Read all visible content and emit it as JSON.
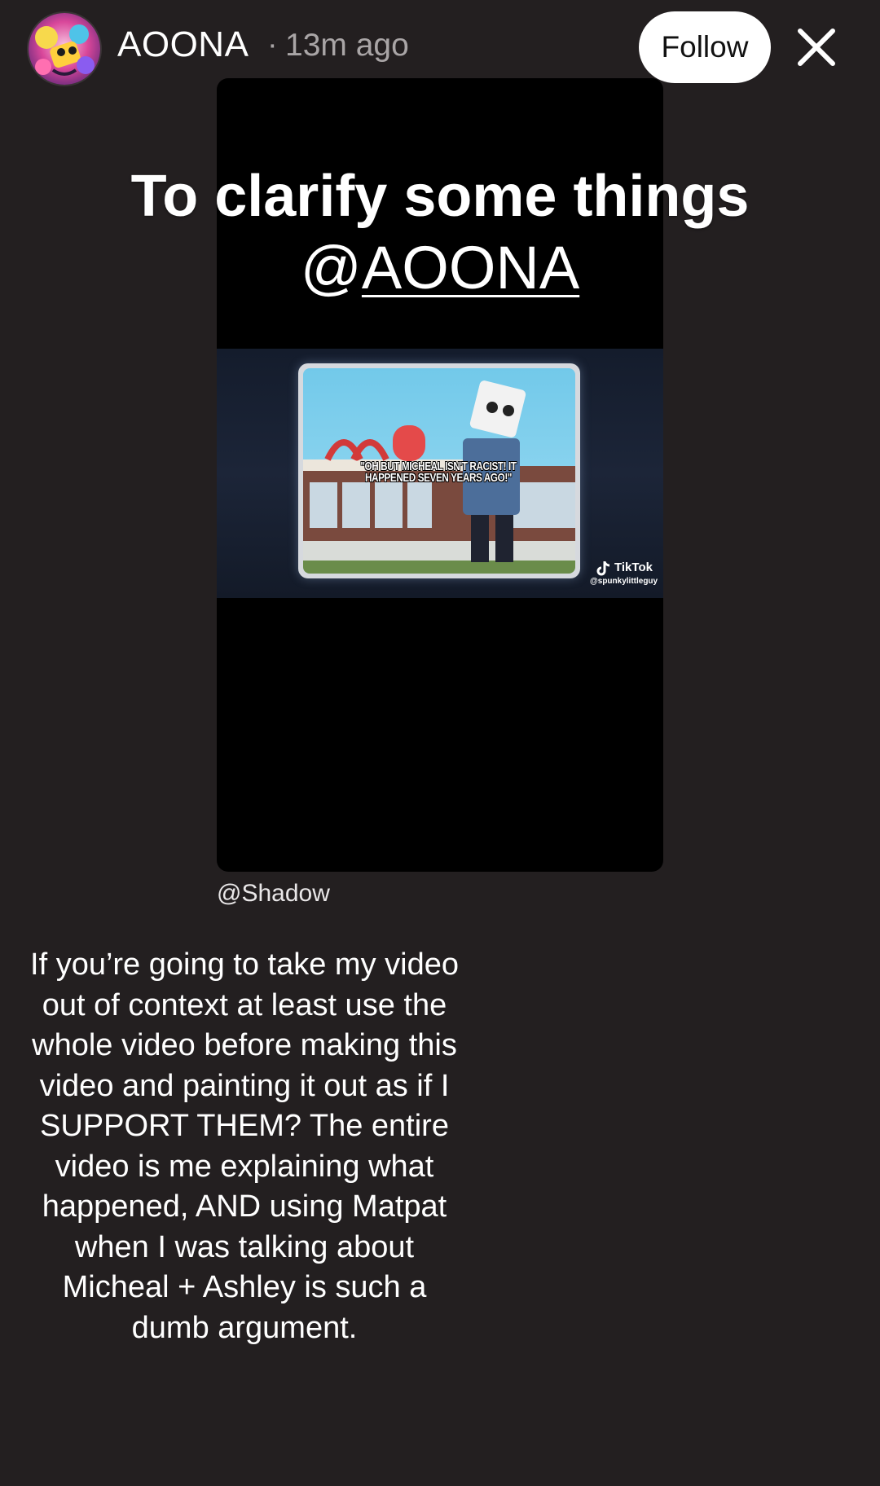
{
  "header": {
    "username": "AOONA",
    "separator": "·",
    "time_ago": "13m ago",
    "follow_label": "Follow",
    "close_icon": "close-icon"
  },
  "overlay": {
    "title": "To clarify some things",
    "mention_prefix": "@",
    "mention_handle": "AOONA"
  },
  "video": {
    "clip_caption": "\"OH BUT MICHEAL ISN'T RACIST! IT HAPPENED SEVEN YEARS AGO!\"",
    "watermark_brand": "TikTok",
    "watermark_handle": "@spunkylittleguy"
  },
  "mention_tag": "@Shadow",
  "body_text": "If you’re going to take my video out of context at least use the whole video before making this video and painting it out as if I SUPPORT THEM? The entire video is me explaining what happened, AND using Matpat when I was talking about Micheal + Ashley is such a dumb argument.",
  "colors": {
    "background": "#231f20",
    "card": "#000000",
    "follow_button": "#ffffff",
    "muted_text": "#a9a5a6"
  }
}
